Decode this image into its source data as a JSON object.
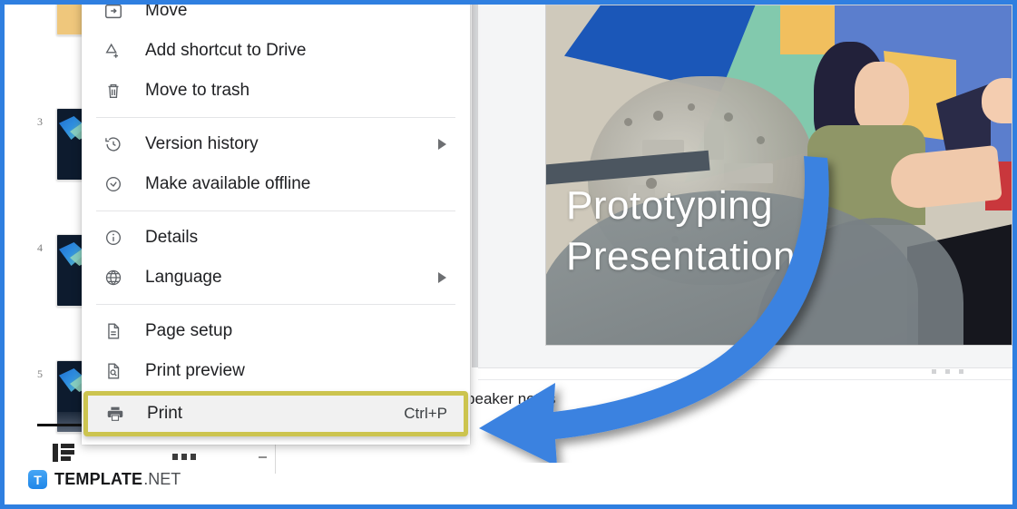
{
  "app": {
    "accent_blue": "#2f7fe0",
    "highlight_border": "#ccc44f",
    "arrow_color": "#3b82e0"
  },
  "filmstrip": {
    "slides": [
      {
        "number": "",
        "kind": "yellow"
      },
      {
        "number": "3",
        "kind": "dark"
      },
      {
        "number": "4",
        "kind": "dark"
      },
      {
        "number": "5",
        "kind": "dark"
      }
    ]
  },
  "toolbar": {
    "layout_icon": "layout-grid-icon",
    "dots_icon": "more-options-icon"
  },
  "slide": {
    "title_line1": "Prototyping",
    "title_line2": "Presentation"
  },
  "notes": {
    "placeholder": "Click to add speaker notes"
  },
  "context_menu": {
    "items": [
      {
        "id": "move",
        "label": "Move",
        "icon": "move-to-folder-icon",
        "accel": "",
        "submenu": false,
        "highlighted": false,
        "separator_after": false
      },
      {
        "id": "add-shortcut",
        "label": "Add shortcut to Drive",
        "icon": "add-shortcut-icon",
        "accel": "",
        "submenu": false,
        "highlighted": false,
        "separator_after": false
      },
      {
        "id": "move-to-trash",
        "label": "Move to trash",
        "icon": "trash-icon",
        "accel": "",
        "submenu": false,
        "highlighted": false,
        "separator_after": true
      },
      {
        "id": "version-history",
        "label": "Version history",
        "icon": "history-clock-icon",
        "accel": "",
        "submenu": true,
        "highlighted": false,
        "separator_after": false
      },
      {
        "id": "make-offline",
        "label": "Make available offline",
        "icon": "offline-check-icon",
        "accel": "",
        "submenu": false,
        "highlighted": false,
        "separator_after": true
      },
      {
        "id": "details",
        "label": "Details",
        "icon": "info-icon",
        "accel": "",
        "submenu": false,
        "highlighted": false,
        "separator_after": false
      },
      {
        "id": "language",
        "label": "Language",
        "icon": "globe-icon",
        "accel": "",
        "submenu": true,
        "highlighted": false,
        "separator_after": true
      },
      {
        "id": "page-setup",
        "label": "Page setup",
        "icon": "document-icon",
        "accel": "",
        "submenu": false,
        "highlighted": false,
        "separator_after": false
      },
      {
        "id": "print-preview",
        "label": "Print preview",
        "icon": "print-preview-icon",
        "accel": "",
        "submenu": false,
        "highlighted": false,
        "separator_after": false
      },
      {
        "id": "print",
        "label": "Print",
        "icon": "printer-icon",
        "accel": "Ctrl+P",
        "submenu": false,
        "highlighted": true,
        "separator_after": false
      }
    ]
  },
  "watermark": {
    "badge_letter": "T",
    "name_bold": "TEMPLATE",
    "name_light": ".NET"
  }
}
